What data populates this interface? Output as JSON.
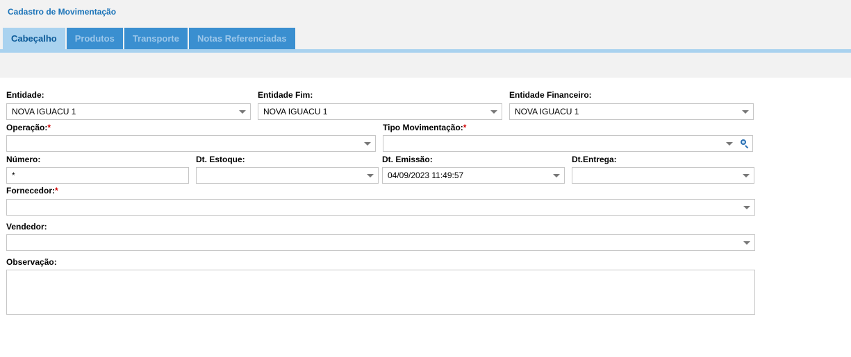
{
  "app": {
    "title": "Cadastro de Movimentação"
  },
  "tabs": [
    {
      "label": "Cabeçalho",
      "active": true
    },
    {
      "label": "Produtos",
      "active": false
    },
    {
      "label": "Transporte",
      "active": false
    },
    {
      "label": "Notas Referenciadas",
      "active": false
    }
  ],
  "required_mark": "*",
  "form": {
    "entidade": {
      "label": "Entidade:",
      "value": "NOVA IGUACU 1"
    },
    "entidade_fim": {
      "label": "Entidade Fim:",
      "value": "NOVA IGUACU 1"
    },
    "entidade_financeiro": {
      "label": "Entidade Financeiro:",
      "value": "NOVA IGUACU 1"
    },
    "operacao": {
      "label": "Operação:",
      "value": ""
    },
    "tipo_movimentacao": {
      "label": "Tipo Movimentação:",
      "value": ""
    },
    "numero": {
      "label": "Número:",
      "value": "*"
    },
    "dt_estoque": {
      "label": "Dt. Estoque:",
      "value": ""
    },
    "dt_emissao": {
      "label": "Dt. Emissão:",
      "value": "04/09/2023 11:49:57"
    },
    "dt_entrega": {
      "label": "Dt.Entrega:",
      "value": ""
    },
    "fornecedor": {
      "label": "Fornecedor:",
      "value": ""
    },
    "vendedor": {
      "label": "Vendedor:",
      "value": ""
    },
    "observacao": {
      "label": "Observação:",
      "value": ""
    }
  },
  "colors": {
    "title": "#1a73b8",
    "tab_active_bg": "#a9d2ef",
    "tab_inactive_bg": "#3a8fd0",
    "required": "#d00000"
  }
}
